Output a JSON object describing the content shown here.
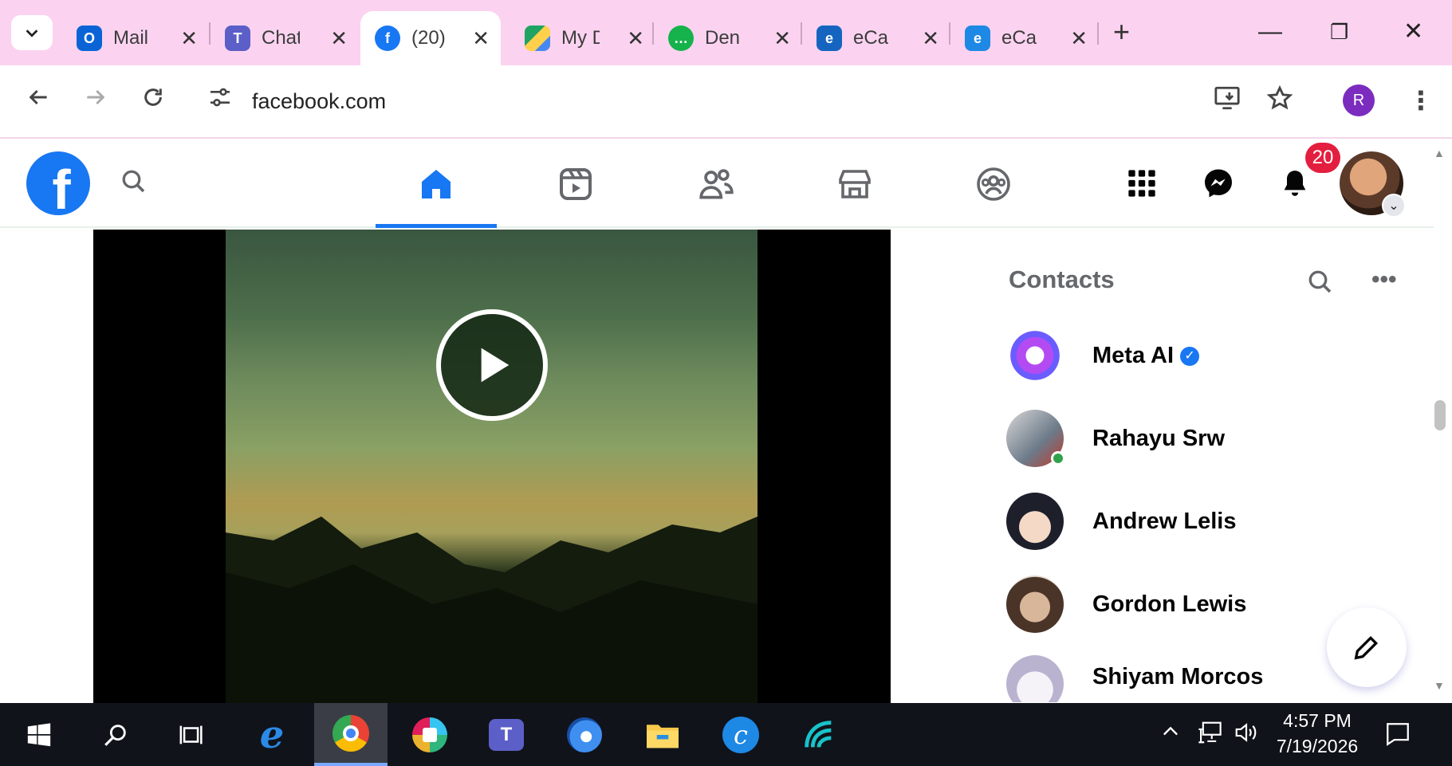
{
  "browser": {
    "tabs": [
      {
        "title": "Mail",
        "favicon": "outlook-icon",
        "color": "#0a64d6"
      },
      {
        "title": "Chat",
        "favicon": "teams-icon",
        "color": "#5b5fc7"
      },
      {
        "title": "(20)",
        "favicon": "facebook-icon",
        "color": "#1877f2",
        "active": true
      },
      {
        "title": "My D",
        "favicon": "drive-icon",
        "color": "#1fa463"
      },
      {
        "title": "Den",
        "favicon": "chat-bubble-icon",
        "color": "#16b24b"
      },
      {
        "title": "eCa",
        "favicon": "ecare-icon",
        "color": "#1565c0"
      },
      {
        "title": "eCa",
        "favicon": "ecare-icon",
        "color": "#1e88e5"
      }
    ],
    "url": "facebook.com",
    "profile_initial": "R"
  },
  "facebook": {
    "notification_count": "20",
    "contacts_title": "Contacts",
    "contacts": [
      {
        "name": "Meta AI",
        "verified": true,
        "online": false
      },
      {
        "name": "Rahayu Srw",
        "verified": false,
        "online": true
      },
      {
        "name": "Andrew Lelis",
        "verified": false,
        "online": false
      },
      {
        "name": "Gordon Lewis",
        "verified": false,
        "online": false
      },
      {
        "name": "Shiyam Morcos",
        "verified": false,
        "online": false
      }
    ]
  },
  "taskbar": {
    "time": "4:57 PM",
    "date": "7/19/2026"
  },
  "colors": {
    "tabstrip": "#fbd3f0",
    "facebook_blue": "#1877f2",
    "badge_red": "#e41e3f",
    "taskbar": "#10131a"
  }
}
